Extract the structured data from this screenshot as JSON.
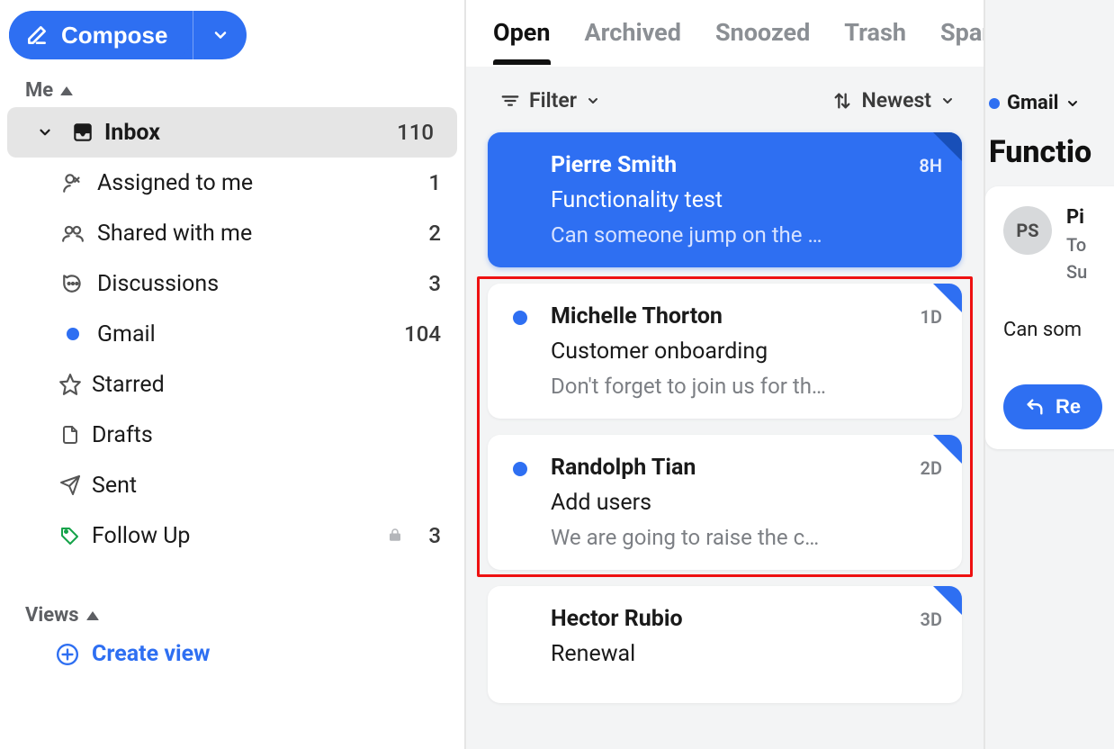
{
  "compose": {
    "label": "Compose"
  },
  "sections": {
    "me": {
      "label": "Me"
    },
    "views": {
      "label": "Views"
    }
  },
  "nav": {
    "inbox": {
      "label": "Inbox",
      "count": "110"
    },
    "assigned": {
      "label": "Assigned to me",
      "count": "1"
    },
    "shared": {
      "label": "Shared with me",
      "count": "2"
    },
    "discussions": {
      "label": "Discussions",
      "count": "3"
    },
    "gmail": {
      "label": "Gmail",
      "count": "104"
    },
    "starred": {
      "label": "Starred"
    },
    "drafts": {
      "label": "Drafts"
    },
    "sent": {
      "label": "Sent"
    },
    "followup": {
      "label": "Follow Up",
      "count": "3"
    }
  },
  "create_view": {
    "label": "Create view"
  },
  "tabs": {
    "open": "Open",
    "archived": "Archived",
    "snoozed": "Snoozed",
    "trash": "Trash",
    "spam": "Spam"
  },
  "toolbar": {
    "filter": "Filter",
    "sort": "Newest"
  },
  "messages": [
    {
      "sender": "Pierre Smith",
      "time": "8H",
      "subject": "Functionality test",
      "preview": "Can someone jump on the …",
      "selected": true
    },
    {
      "sender": "Michelle Thorton",
      "time": "1D",
      "subject": "Customer onboarding",
      "preview": "Don't forget to join us for th…",
      "unread": true
    },
    {
      "sender": "Randolph Tian",
      "time": "2D",
      "subject": "Add users",
      "preview": "We are going to raise the c…",
      "unread": true
    },
    {
      "sender": "Hector Rubio",
      "time": "3D",
      "subject": "Renewal",
      "preview": ""
    }
  ],
  "right": {
    "account": "Gmail",
    "title": "Functio",
    "avatar": "PS",
    "from": "Pi",
    "to": "To",
    "subj": "Su",
    "body": "Can som",
    "reply": "Re"
  }
}
